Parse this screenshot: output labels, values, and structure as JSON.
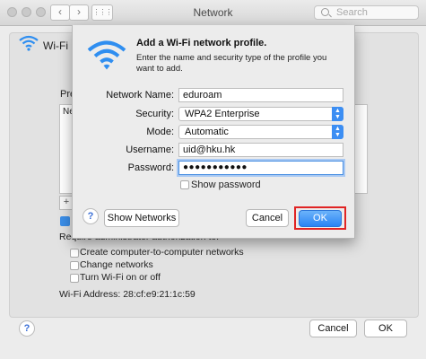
{
  "window": {
    "title": "Network"
  },
  "search": {
    "placeholder": "Search"
  },
  "toolbar": {
    "back_glyph": "‹",
    "forward_glyph": "›",
    "grid_glyph": "⋮⋮⋮"
  },
  "background": {
    "wifi_label": "Wi-Fi",
    "preferred_label_fragment": "Pre",
    "list_fragment": "Ne",
    "plus_glyph": "+",
    "require_admin": "Require administrator authorization to:",
    "options": [
      {
        "label": "Create computer-to-computer networks",
        "checked": false
      },
      {
        "label": "Change networks",
        "checked": false
      },
      {
        "label": "Turn Wi-Fi on or off",
        "checked": false
      }
    ],
    "wifi_address_label": "Wi-Fi Address:",
    "wifi_address": "28:cf:e9:21:1c:59",
    "cancel_label": "Cancel",
    "ok_label": "OK",
    "help_glyph": "?"
  },
  "dialog": {
    "title": "Add a Wi-Fi network profile.",
    "description": "Enter the name and security type of the profile you want to add.",
    "fields": {
      "network_name": {
        "label": "Network Name:",
        "value": "eduroam"
      },
      "security": {
        "label": "Security:",
        "value": "WPA2 Enterprise"
      },
      "mode": {
        "label": "Mode:",
        "value": "Automatic"
      },
      "username": {
        "label": "Username:",
        "value": "uid@hku.hk"
      },
      "password": {
        "label": "Password:",
        "value": "●●●●●●●●●●●"
      }
    },
    "show_password": {
      "label": "Show password",
      "checked": false
    },
    "show_networks_label": "Show Networks",
    "cancel_label": "Cancel",
    "ok_label": "OK",
    "help_glyph": "?"
  },
  "colors": {
    "accent": "#2a84f4",
    "highlight": "#e02424",
    "wifi_icon": "#2f8ef0"
  }
}
